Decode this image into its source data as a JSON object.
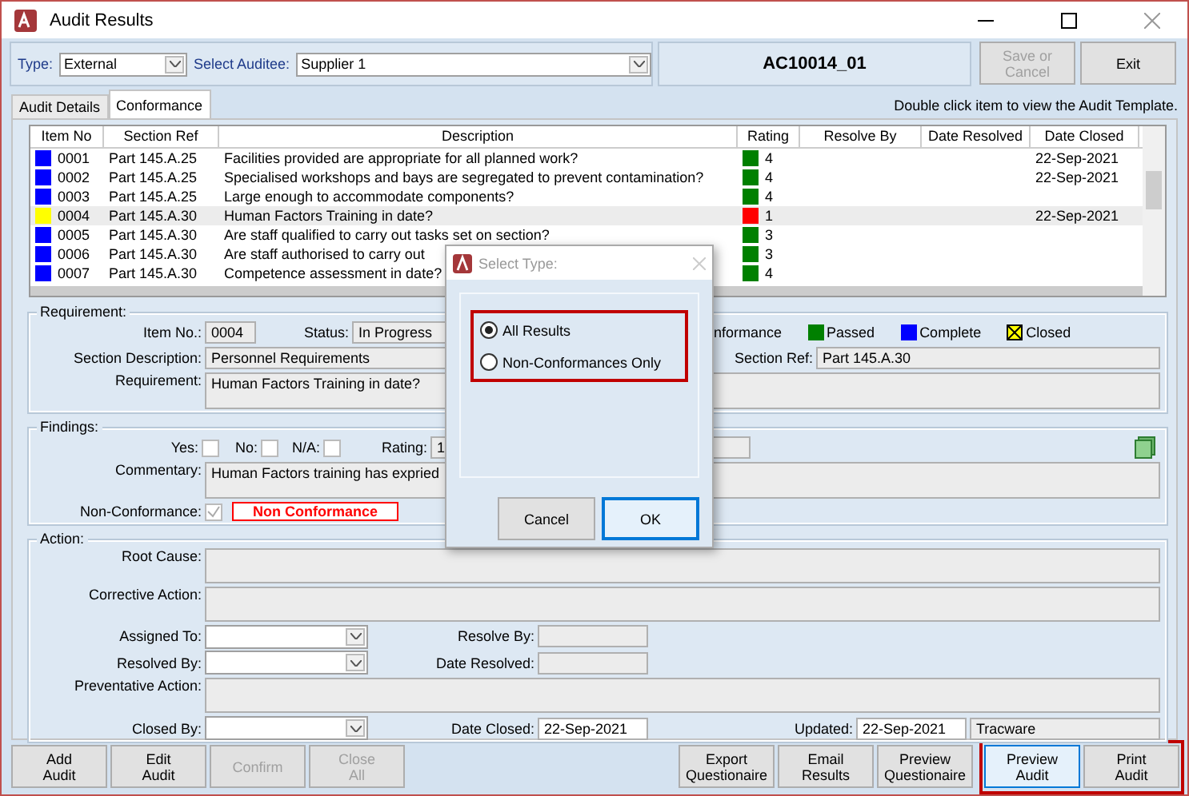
{
  "window": {
    "title": "Audit Results"
  },
  "filter": {
    "type_label": "Type:",
    "type_value": "External",
    "auditee_label": "Select Auditee:",
    "auditee_value": "Supplier 1"
  },
  "audit_id": "AC10014_01",
  "header_buttons": [
    {
      "label": "Save or\nCancel",
      "disabled": true
    },
    {
      "label": "Exit",
      "disabled": false
    }
  ],
  "tabs": [
    {
      "label": "Audit Details",
      "selected": false
    },
    {
      "label": "Conformance",
      "selected": true
    }
  ],
  "hint": "Double click item to view the Audit Template.",
  "table": {
    "columns": [
      "Item No",
      "Section Ref",
      "Description",
      "Rating",
      "Resolve By",
      "Date Resolved",
      "Date Closed"
    ],
    "rows": [
      {
        "item_no": "0001",
        "color": "#0000ff",
        "section_ref": "Part 145.A.25",
        "description": "Facilities provided are appropriate for all planned work?",
        "rating": {
          "value": "4",
          "color": "#008000"
        },
        "date_closed": "22-Sep-2021",
        "selected": false
      },
      {
        "item_no": "0002",
        "color": "#0000ff",
        "section_ref": "Part 145.A.25",
        "description": "Specialised workshops and bays are segregated to prevent contamination?",
        "rating": {
          "value": "4",
          "color": "#008000"
        },
        "date_closed": "22-Sep-2021",
        "selected": false
      },
      {
        "item_no": "0003",
        "color": "#0000ff",
        "section_ref": "Part 145.A.25",
        "description": "Large enough to accommodate components?",
        "rating": {
          "value": "4",
          "color": "#008000"
        },
        "selected": false
      },
      {
        "item_no": "0004",
        "color": "#ffff00",
        "section_ref": "Part 145.A.30",
        "description": "Human Factors Training in date?",
        "rating": {
          "value": "1",
          "color": "#ff0000"
        },
        "date_closed": "22-Sep-2021",
        "selected": true
      },
      {
        "item_no": "0005",
        "color": "#0000ff",
        "section_ref": "Part 145.A.30",
        "description": "Are staff qualified to carry out tasks set on section?",
        "rating": {
          "value": "3",
          "color": "#008000"
        },
        "selected": false
      },
      {
        "item_no": "0006",
        "color": "#0000ff",
        "section_ref": "Part 145.A.30",
        "description": "Are staff authorised to carry out",
        "rating": {
          "value": "3",
          "color": "#008000"
        },
        "selected": false
      },
      {
        "item_no": "0007",
        "color": "#0000ff",
        "section_ref": "Part 145.A.30",
        "description": "Competence assessment in date?",
        "rating": {
          "value": "4",
          "color": "#008000"
        },
        "selected": false
      }
    ]
  },
  "requirement": {
    "title": "Requirement:",
    "item_no_label": "Item No.:",
    "item_no": "0004",
    "status_label": "Status:",
    "status": "In Progress",
    "legend": [
      {
        "label": "nformance"
      },
      {
        "label": "Passed",
        "color": "#008000"
      },
      {
        "label": "Complete",
        "color": "#0000ff"
      },
      {
        "label": "Closed",
        "color": "#ffff00"
      }
    ],
    "section_description_label": "Section Description:",
    "section_description": "Personnel Requirements",
    "section_ref_label": "Section Ref:",
    "section_ref": "Part 145.A.30",
    "requirement_label": "Requirement:",
    "requirement": "Human Factors Training in date?"
  },
  "findings": {
    "title": "Findings:",
    "checks": [
      {
        "label": "Yes:",
        "checked": false
      },
      {
        "label": "No:",
        "checked": false
      },
      {
        "label": "N/A:",
        "checked": false
      }
    ],
    "rating_label": "Rating:",
    "rating": "1",
    "commentary_label": "Commentary:",
    "commentary": "Human Factors training has expried",
    "non_conformance_label": "Non-Conformance:",
    "non_conformance_checked": true,
    "non_conformance_tag": "Non Conformance"
  },
  "action": {
    "title": "Action:",
    "root_cause_label": "Root Cause:",
    "corrective_action_label": "Corrective Action:",
    "assigned_to_label": "Assigned To:",
    "resolve_by_label": "Resolve By:",
    "resolved_by_label": "Resolved By:",
    "date_resolved_label": "Date Resolved:",
    "preventative_action_label": "Preventative Action:",
    "closed_by_label": "Closed By:",
    "date_closed_label": "Date Closed:",
    "date_closed": "22-Sep-2021",
    "updated_label": "Updated:",
    "updated": "22-Sep-2021",
    "updated_by": "Tracware"
  },
  "footer_buttons_left": [
    {
      "label": "Add\nAudit",
      "disabled": false
    },
    {
      "label": "Edit\nAudit",
      "disabled": false
    },
    {
      "label": "Confirm",
      "disabled": true
    },
    {
      "label": "Close\nAll",
      "disabled": true
    }
  ],
  "footer_buttons_right": [
    {
      "label": "Export\nQuestionaire",
      "focused": false
    },
    {
      "label": "Email\nResults",
      "focused": false
    },
    {
      "label": "Preview\nQuestionaire",
      "focused": false
    },
    {
      "label": "Preview\nAudit",
      "focused": true
    },
    {
      "label": "Print\nAudit",
      "focused": false
    }
  ],
  "footer_annotated": true,
  "dialog": {
    "title": "Select Type:",
    "annotated": true,
    "options": [
      {
        "label": "All Results",
        "selected": true
      },
      {
        "label": "Non-Conformances Only",
        "selected": false
      }
    ],
    "buttons": [
      {
        "label": "Cancel",
        "focused": false
      },
      {
        "label": "OK",
        "focused": true
      }
    ]
  }
}
